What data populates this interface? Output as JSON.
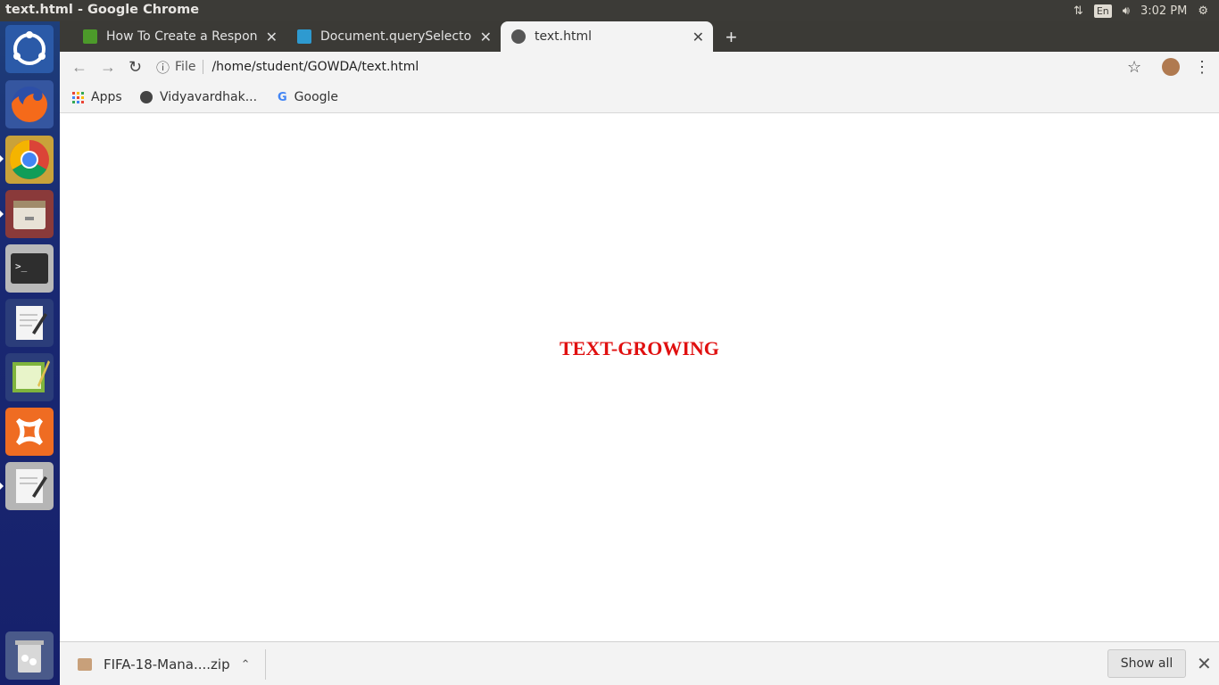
{
  "window": {
    "title": "text.html - Google Chrome"
  },
  "tray": {
    "lang": "En",
    "time": "3:02 PM"
  },
  "launcher": {
    "items": [
      {
        "name": "ubuntu-dash-icon"
      },
      {
        "name": "firefox-icon"
      },
      {
        "name": "chrome-icon"
      },
      {
        "name": "files-icon"
      },
      {
        "name": "terminal-icon"
      },
      {
        "name": "text-editor-icon"
      },
      {
        "name": "notepadqq-icon"
      },
      {
        "name": "xampp-icon"
      },
      {
        "name": "text-editor-2-icon"
      },
      {
        "name": "trash-icon"
      }
    ]
  },
  "tabs": [
    {
      "label": "How To Create a Responsi",
      "active": false
    },
    {
      "label": "Document.querySelector()",
      "active": false
    },
    {
      "label": "text.html",
      "active": true
    }
  ],
  "toolbar": {
    "file_label": "File",
    "url": "/home/student/GOWDA/text.html"
  },
  "bookmarks": [
    {
      "label": "Apps"
    },
    {
      "label": "Vidyavardhak..."
    },
    {
      "label": "Google"
    }
  ],
  "page": {
    "text": "TEXT-GROWING",
    "color": "#e01010"
  },
  "downloads": {
    "filename": "FIFA-18-Mana....zip",
    "show_all": "Show all"
  }
}
